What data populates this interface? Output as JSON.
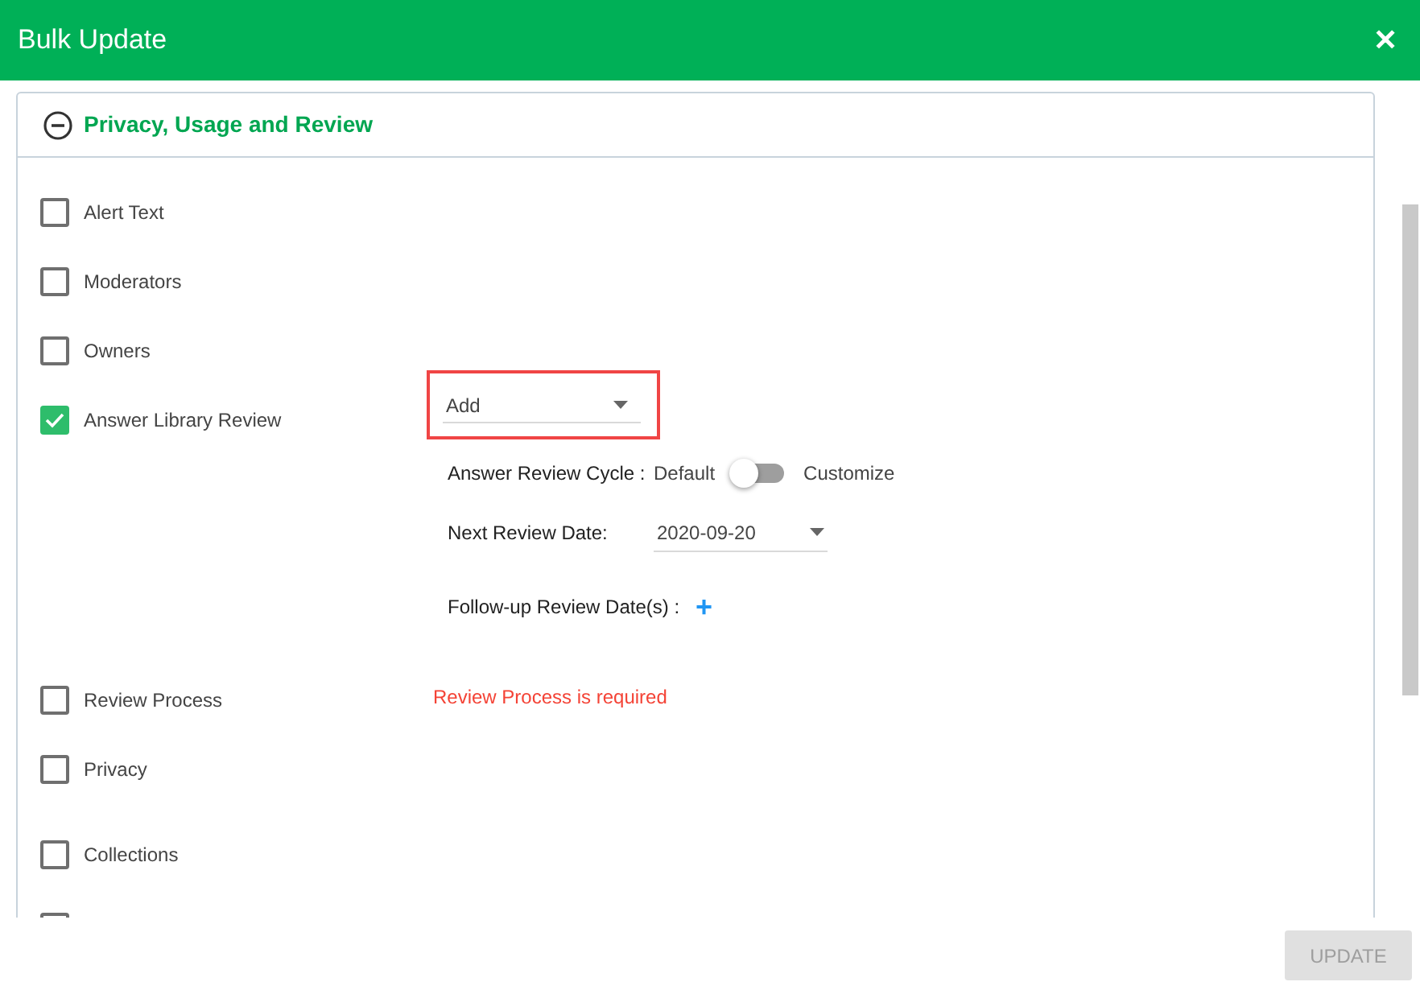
{
  "window": {
    "title": "Bulk Update",
    "close": "✕"
  },
  "section": {
    "title": "Privacy, Usage and Review",
    "expanded": true
  },
  "items": [
    {
      "label": "Alert Text",
      "checked": false
    },
    {
      "label": "Moderators",
      "checked": false
    },
    {
      "label": "Owners",
      "checked": false
    },
    {
      "label": "Answer Library Review",
      "checked": true,
      "details": {
        "dropdown": {
          "value": "Add"
        },
        "review_cycle": {
          "label": "Answer Review Cycle :",
          "off_label": "Default",
          "on_label": "Customize",
          "on": false
        },
        "next_review": {
          "label": "Next Review Date:",
          "value": "2020-09-20"
        },
        "follow_up": {
          "label": "Follow-up Review Date(s) :",
          "add": "+"
        }
      }
    },
    {
      "label": "Review Process",
      "checked": false,
      "error": "Review Process is required"
    },
    {
      "label": "Privacy",
      "checked": false
    },
    {
      "label": "Collections",
      "checked": false
    },
    {
      "checked": false
    }
  ],
  "footer": {
    "update_button": {
      "label": "UPDATE",
      "disabled": true
    }
  }
}
